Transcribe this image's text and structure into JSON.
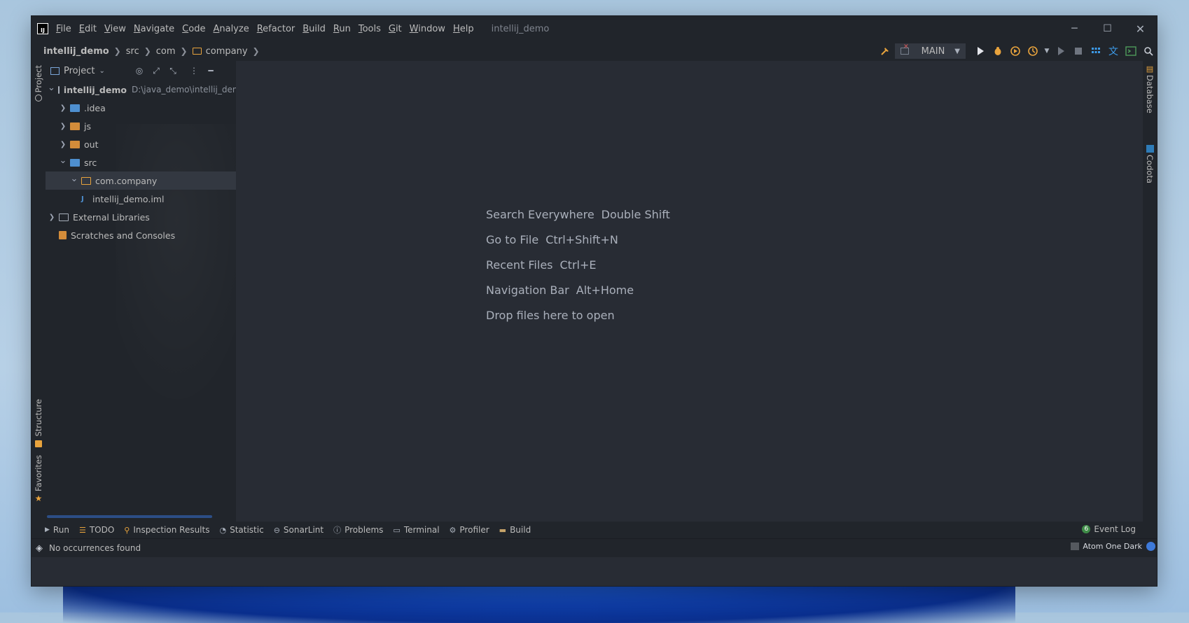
{
  "window": {
    "app_logo": "IJ",
    "title": "intellij_demo",
    "menu": [
      "File",
      "Edit",
      "View",
      "Navigate",
      "Code",
      "Analyze",
      "Refactor",
      "Build",
      "Run",
      "Tools",
      "Git",
      "Window",
      "Help"
    ],
    "controls": {
      "minimize": "─",
      "maximize": "☐",
      "close": "✕"
    }
  },
  "breadcrumb": [
    {
      "label": "intellij_demo",
      "bold": true
    },
    {
      "label": "src"
    },
    {
      "label": "com"
    },
    {
      "label": "company",
      "icon": "folder-icon"
    }
  ],
  "toolbar": {
    "run_config": "MAIN",
    "icons": [
      "hammer-icon",
      "run-config-icon",
      "run-icon",
      "debug-icon",
      "coverage-icon",
      "profile-icon",
      "dropdown-icon",
      "resume-icon",
      "stop-icon",
      "grid-icon",
      "translate-icon",
      "terminal-icon",
      "search-icon"
    ]
  },
  "left_tool_tabs": {
    "project": "Project",
    "structure": "Structure",
    "favorites": "Favorites"
  },
  "right_tool_tabs": {
    "database": "Database",
    "codota": "Codota"
  },
  "project_panel": {
    "title": "Project",
    "tree": [
      {
        "name": "intellij_demo",
        "path": "D:\\java_demo\\intellij_dem",
        "level": 0,
        "arrow": "down",
        "icon": "module",
        "bold": true
      },
      {
        "name": ".idea",
        "level": 1,
        "arrow": "right",
        "icon": "folder-blue"
      },
      {
        "name": "js",
        "level": 1,
        "arrow": "right",
        "icon": "folder-orange"
      },
      {
        "name": "out",
        "level": 1,
        "arrow": "right",
        "icon": "folder-orange"
      },
      {
        "name": "src",
        "level": 1,
        "arrow": "down",
        "icon": "folder-src"
      },
      {
        "name": "com.company",
        "level": 2,
        "arrow": "down",
        "icon": "package",
        "selected": true
      },
      {
        "name": "intellij_demo.iml",
        "level": 2,
        "arrow": "none",
        "icon": "iml"
      },
      {
        "name": "External Libraries",
        "level": 0,
        "arrow": "right",
        "icon": "library"
      },
      {
        "name": "Scratches and Consoles",
        "level": 0,
        "arrow": "none",
        "icon": "scratch"
      }
    ]
  },
  "editor_hints": [
    {
      "text": "Search Everywhere",
      "key": "Double Shift"
    },
    {
      "text": "Go to File",
      "key": "Ctrl+Shift+N"
    },
    {
      "text": "Recent Files",
      "key": "Ctrl+E"
    },
    {
      "text": "Navigation Bar",
      "key": "Alt+Home"
    },
    {
      "text": "Drop files here to open",
      "key": ""
    }
  ],
  "bottom_tabs": [
    {
      "label": "Run",
      "icon": "run-icon"
    },
    {
      "label": "TODO",
      "icon": "todo-icon"
    },
    {
      "label": "Inspection Results",
      "icon": "inspection-icon"
    },
    {
      "label": "Statistic",
      "icon": "statistic-icon"
    },
    {
      "label": "SonarLint",
      "icon": "sonarlint-icon"
    },
    {
      "label": "Problems",
      "icon": "problems-icon"
    },
    {
      "label": "Terminal",
      "icon": "terminal-icon"
    },
    {
      "label": "Profiler",
      "icon": "profiler-icon"
    },
    {
      "label": "Build",
      "icon": "build-icon"
    }
  ],
  "event_log": {
    "label": "Event Log",
    "count": "6"
  },
  "status": {
    "message": "No occurrences found",
    "theme": "Atom One Dark"
  }
}
